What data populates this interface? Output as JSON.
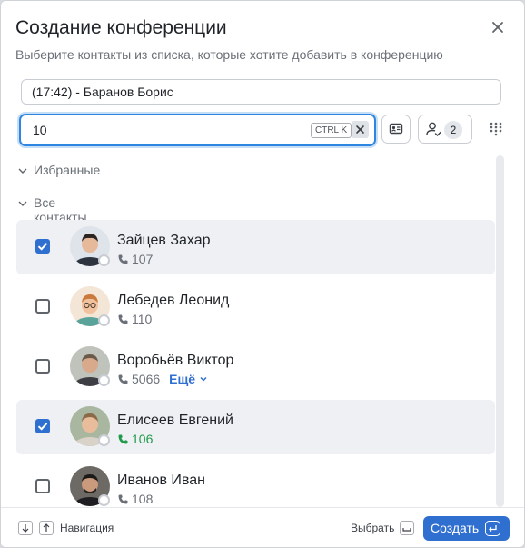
{
  "dialog": {
    "title": "Создание конференции",
    "subtitle": "Выберите контакты из списка, которые хотите добавить в конференцию"
  },
  "topic": {
    "value": "(17:42) - Баранов Борис"
  },
  "search": {
    "value": "10",
    "shortcut": "CTRL K"
  },
  "toolbar": {
    "selected_count": "2"
  },
  "groups": {
    "favorites": "Избранные",
    "all_contacts": "Все контакты"
  },
  "contacts": [
    {
      "name": "Зайцев Захар",
      "phone": "107",
      "checked": true
    },
    {
      "name": "Лебедев Леонид",
      "phone": "110",
      "checked": false
    },
    {
      "name": "Воробьёв Виктор",
      "phone": "5066",
      "checked": false,
      "more": "Ещё"
    },
    {
      "name": "Елисеев Евгений",
      "phone": "106",
      "checked": true,
      "phone_color": "#1f9a4a"
    },
    {
      "name": "Иванов Иван",
      "phone": "108",
      "checked": false
    }
  ],
  "footer": {
    "nav_label": "Навигация",
    "choose_label": "Выбрать",
    "create_label": "Создать"
  },
  "colors": {
    "accent": "#2f6fd0",
    "focus": "#2f86e0",
    "online_phone": "#1f9a4a"
  }
}
